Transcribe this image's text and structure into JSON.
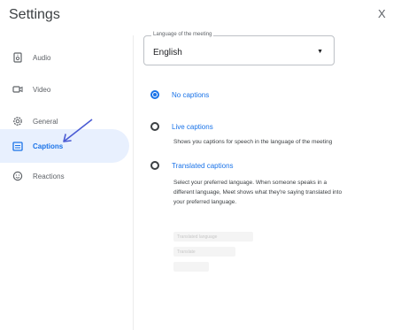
{
  "dialog": {
    "title": "Settings",
    "close_glyph": "X"
  },
  "sidebar": {
    "items": [
      {
        "label": "Audio",
        "icon": "speaker-icon",
        "active": false
      },
      {
        "label": "Video",
        "icon": "video-camera-icon",
        "active": false
      },
      {
        "label": "General",
        "icon": "gear-icon",
        "active": false
      },
      {
        "label": "Captions",
        "icon": "closed-captions-icon",
        "active": true
      },
      {
        "label": "Reactions",
        "icon": "smiley-icon",
        "active": false
      }
    ]
  },
  "captions": {
    "language_select": {
      "label": "Language of the meeting",
      "value": "English"
    },
    "options": [
      {
        "label": "No captions",
        "checked": true,
        "description": []
      },
      {
        "label": "Live captions",
        "checked": false,
        "description": [
          "Shows you captions for speech in the language of the meeting"
        ]
      },
      {
        "label": "Translated captions",
        "checked": false,
        "description": [
          "Select your preferred language. When someone speaks in a",
          "different language, Meet shows what they're saying translated into",
          "your preferred language."
        ]
      }
    ],
    "translation_fields": [
      "Translated language",
      "Translate"
    ]
  },
  "colors": {
    "accent": "#1a73e8",
    "active_bg": "#e8f0fe",
    "annotation_arrow": "#4a5bd4"
  }
}
